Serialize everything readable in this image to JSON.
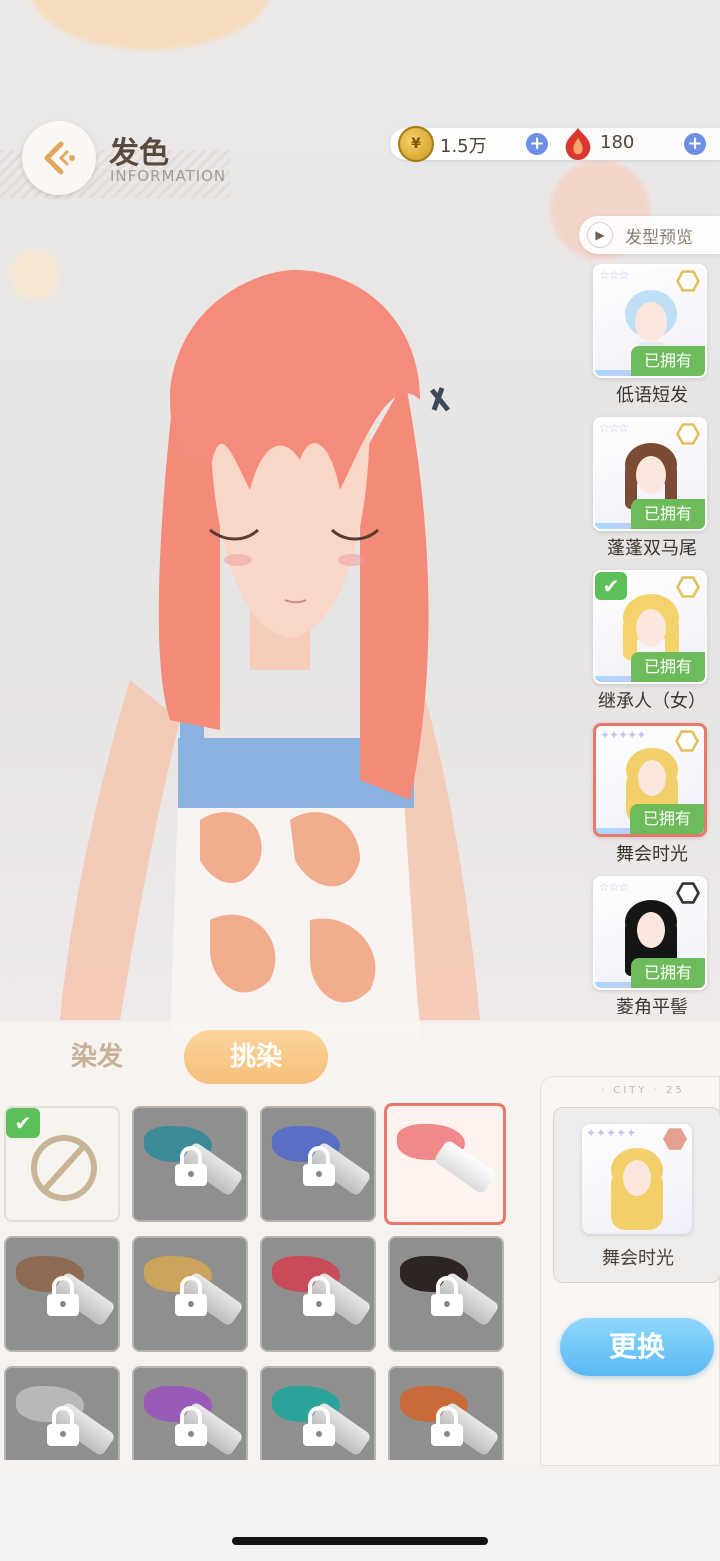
{
  "header": {
    "title": "发色",
    "subtitle": "INFORMATION"
  },
  "currency": {
    "coins": "1.5万",
    "gems": "180"
  },
  "preview": {
    "label": "发型预览"
  },
  "hairstyles": [
    {
      "name": "低语短发",
      "owned_label": "已拥有",
      "hair_color": "#bfe0f4"
    },
    {
      "name": "蓬蓬双马尾",
      "owned_label": "已拥有",
      "hair_color": "#7b4b33"
    },
    {
      "name": "继承人（女）",
      "owned_label": "已拥有",
      "hair_color": "#f4d36a"
    },
    {
      "name": "舞会时光",
      "owned_label": "已拥有",
      "hair_color": "#f2cf68"
    },
    {
      "name": "菱角平髻",
      "owned_label": "已拥有",
      "hair_color": "#151515"
    }
  ],
  "tabs": {
    "dye": "染发",
    "highlight": "挑染"
  },
  "swatches": [
    {
      "color": "none",
      "locked": false,
      "selected": true
    },
    {
      "color": "#3a8a98",
      "locked": true
    },
    {
      "color": "#5a6fc4",
      "locked": true
    },
    {
      "color": "#f08a8a",
      "locked": false,
      "active": true
    },
    {
      "color": "#8e6a52",
      "locked": true
    },
    {
      "color": "#c9a45a",
      "locked": true
    },
    {
      "color": "#c94a58",
      "locked": true
    },
    {
      "color": "#2e2424",
      "locked": true
    },
    {
      "color": "#b8b8b8",
      "locked": true
    },
    {
      "color": "#9a5ab8",
      "locked": true
    },
    {
      "color": "#2aa39a",
      "locked": true
    },
    {
      "color": "#c86a3a",
      "locked": true
    }
  ],
  "selected_style": {
    "name": "舞会时光"
  },
  "actions": {
    "change": "更换"
  },
  "colors": {
    "owned_badge": "#6dbb5a",
    "accent_selected": "#e8786a",
    "change_button": "#5ab8f2",
    "highlight_tab": "#f5c07a"
  }
}
